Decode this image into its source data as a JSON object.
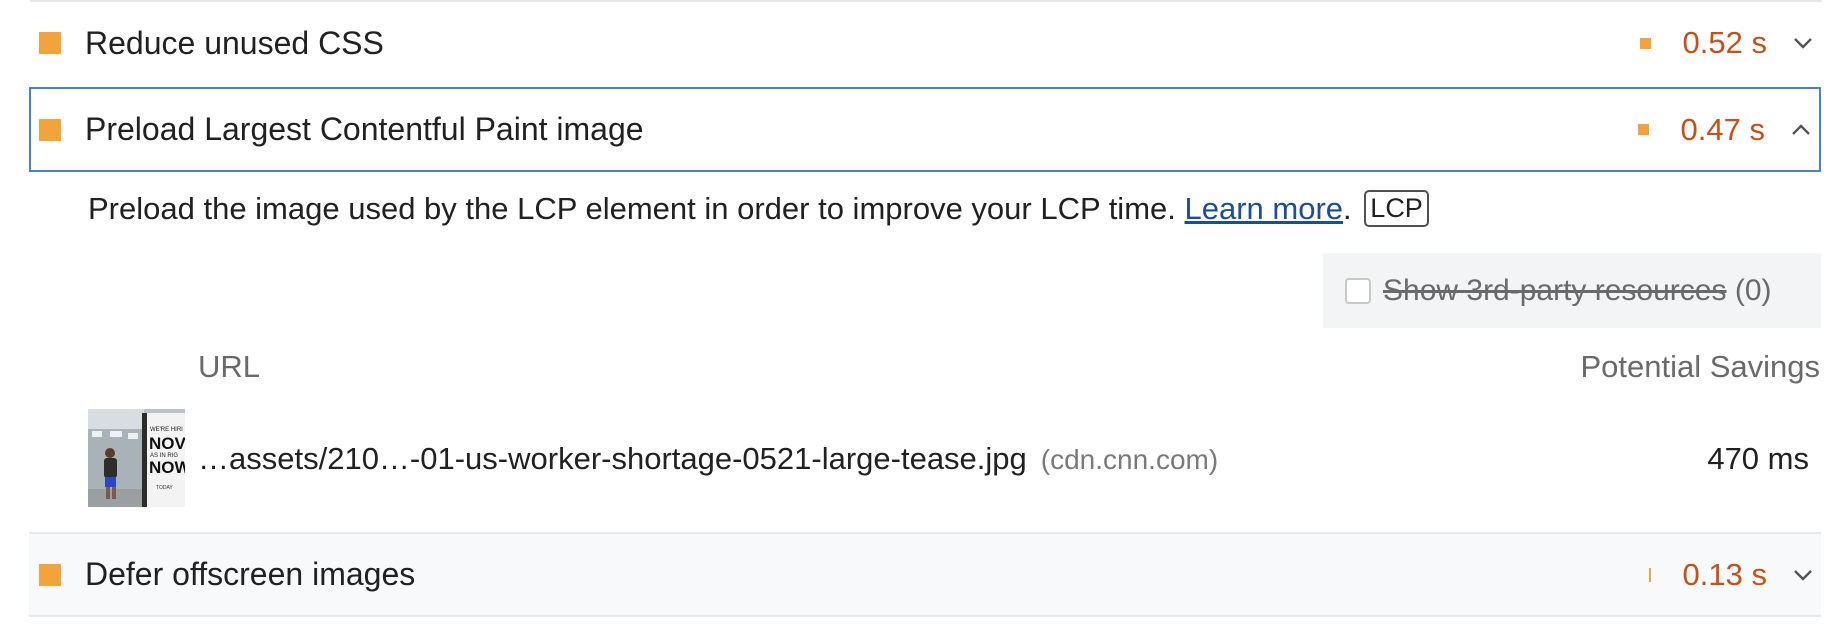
{
  "audits": [
    {
      "title": "Reduce unused CSS",
      "value": "0.52 s",
      "expanded": false
    },
    {
      "title": "Preload Largest Contentful Paint image",
      "value": "0.47 s",
      "expanded": true
    },
    {
      "title": "Defer offscreen images",
      "value": "0.13 s",
      "expanded": false
    }
  ],
  "detail": {
    "description": "Preload the image used by the LCP element in order to improve your LCP time.",
    "learn_more": "Learn more",
    "period": ".",
    "badge": "LCP",
    "filter_label": "Show 3rd-party resources",
    "filter_count": "(0)",
    "col_url": "URL",
    "col_savings": "Potential Savings",
    "rows": [
      {
        "url": "…assets/210…-01-us-worker-shortage-0521-large-tease.jpg",
        "host": "(cdn.cnn.com)",
        "savings": "470 ms",
        "thumb_text": [
          "WE'RE HIRI",
          "NOV",
          "AS IN RIG",
          "NOW",
          "TODAY"
        ]
      }
    ]
  },
  "colors": {
    "average": "#f2a33a",
    "value_text": "#c5501a",
    "focus_border": "#4a7fd2",
    "link": "#1a4ca0"
  }
}
